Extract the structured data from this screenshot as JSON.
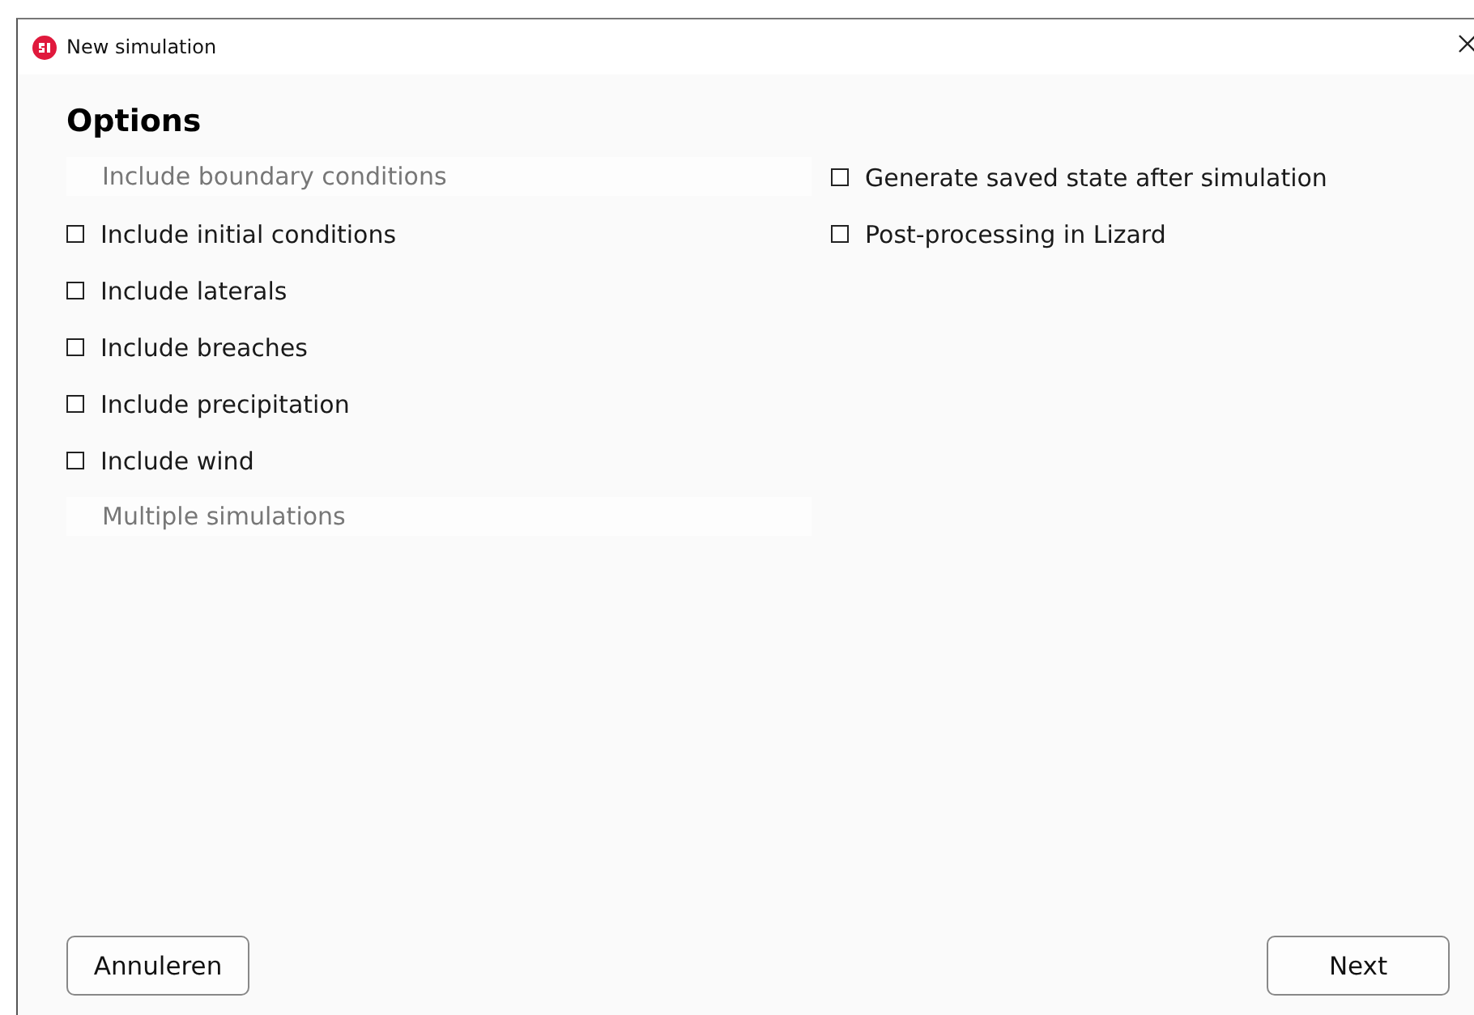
{
  "window": {
    "title": "New simulation"
  },
  "heading": "Options",
  "left_options": [
    {
      "label": "Include boundary conditions",
      "disabled": true
    },
    {
      "label": "Include initial conditions",
      "checked": false,
      "disabled": false
    },
    {
      "label": "Include laterals",
      "checked": false,
      "disabled": false
    },
    {
      "label": "Include breaches",
      "checked": false,
      "disabled": false
    },
    {
      "label": "Include precipitation",
      "checked": false,
      "disabled": false
    },
    {
      "label": "Include wind",
      "checked": false,
      "disabled": false
    },
    {
      "label": "Multiple simulations",
      "disabled": true
    }
  ],
  "right_options": [
    {
      "label": "Generate saved state after simulation",
      "checked": false,
      "disabled": false
    },
    {
      "label": "Post-processing in Lizard",
      "checked": false,
      "disabled": false
    }
  ],
  "buttons": {
    "cancel": "Annuleren",
    "next": "Next"
  }
}
